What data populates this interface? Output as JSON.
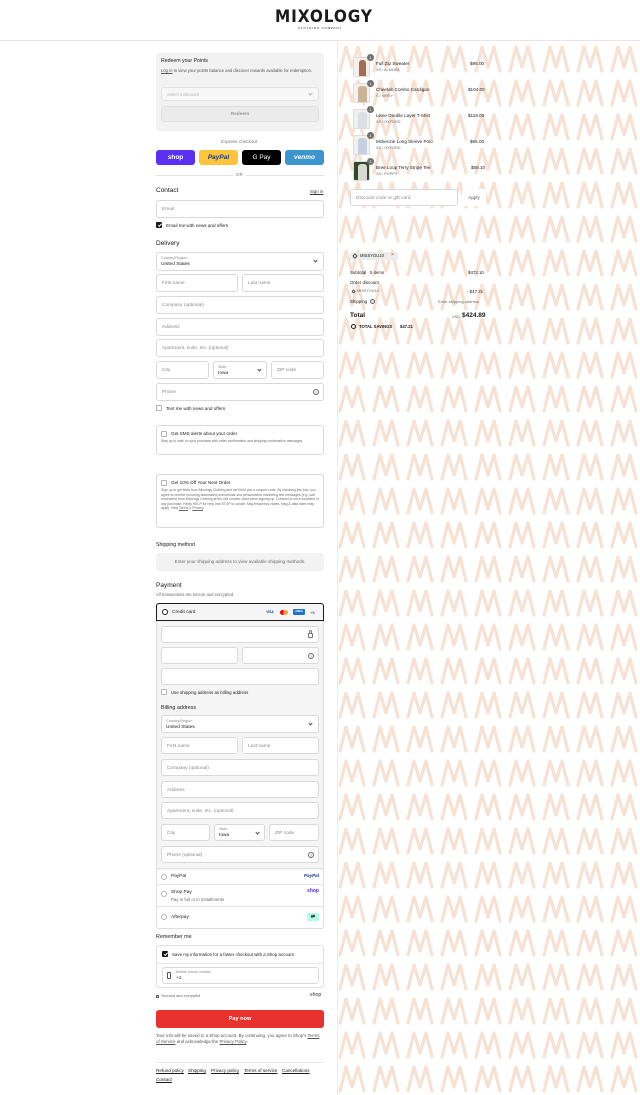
{
  "brand": {
    "name": "MIXOLOGY",
    "tagline": "CLOTHING COMPANY"
  },
  "rewards": {
    "title": "Redeem your Points",
    "login_link": "Log in",
    "text": " to view your points balance and discover rewards available for redemption.",
    "select_placeholder": "Select a discount",
    "redeem_label": "Redeem"
  },
  "express": {
    "label": "Express checkout",
    "or": "OR",
    "shop": "shop",
    "paypal": "PayPal",
    "gpay": "G Pay",
    "venmo": "venmo"
  },
  "contact": {
    "title": "Contact",
    "sign_in": "Sign in",
    "email_placeholder": "Email",
    "newsletter_label": "Email me with news and offers"
  },
  "delivery": {
    "title": "Delivery",
    "country_label": "Country/Region",
    "country": "United States",
    "first_name": "First name",
    "last_name": "Last name",
    "company": "Company (optional)",
    "address": "Address",
    "apartment": "Apartment, suite, etc. (optional)",
    "city": "City",
    "state_label": "State",
    "state": "Iowa",
    "zip": "ZIP code",
    "phone": "Phone",
    "text_offers": "Text me with news and offers"
  },
  "sms_box": {
    "title": "Get SMS alerts about your order",
    "desc": "Stay up to date on your purchase with order confirmation and shipping confirmation messages."
  },
  "promo_box": {
    "title": "Get 10% Off Your Next Order",
    "desc": "Sign up to get texts from Mixology Clothing and we'll text you a coupon code. By checking this box, you agree to receive recurring automated promotional and personalized marketing text messages (e.g. cart reminders) from Mixology Clothing at the cell number used when signing up. Consent is not a condition of any purchase. Reply HELP for help and STOP to cancel. Msg frequency varies. Msg & data rates may apply. View ",
    "terms": "Terms",
    "and": " & ",
    "privacy": "Privacy",
    "end": "."
  },
  "shipping_method": {
    "title": "Shipping method",
    "notice": "Enter your shipping address to view available shipping methods."
  },
  "payment": {
    "title": "Payment",
    "subtitle": "All transactions are secure and encrypted.",
    "credit_card": "Credit card",
    "cards": [
      "VISA",
      "MC",
      "AMEX",
      "+5"
    ],
    "use_shipping": "Use shipping address as billing address",
    "billing_title": "Billing address",
    "phone_optional": "Phone (optional)",
    "paypal": "PayPal",
    "shop_pay": "Shop Pay",
    "shop_pay_sub": "Pay in full or in installments",
    "afterpay": "Afterpay"
  },
  "remember": {
    "title": "Remember me",
    "save_label": "Save my information for a faster checkout with a Shop account",
    "mobile_label": "Mobile phone number",
    "mobile_value": "+1",
    "secure": "Secured and encrypted",
    "shop": "shop"
  },
  "pay_now": "Pay now",
  "disclaimer": {
    "text": "Your info will be saved to a Shop account. By continuing, you agree to Shop's ",
    "tos": "Terms of Service",
    "mid": " and acknowledge the ",
    "privacy": "Privacy Policy",
    "end": "."
  },
  "footer": [
    "Refund policy",
    "Shipping",
    "Privacy policy",
    "Terms of service",
    "Cancellations",
    "Contact"
  ],
  "cart": {
    "items": [
      {
        "qty": "1",
        "name": "Full Zip Sweater",
        "variant": "XS / ALMURA",
        "price": "$96.00"
      },
      {
        "qty": "1",
        "name": "Cheetah Combo Cardigan",
        "variant": "S / IVREY",
        "price": "$104.00"
      },
      {
        "qty": "1",
        "name": "Lexie Double Layer T-Shirt",
        "variant": "XS / OXFORD",
        "price": "$118.00"
      },
      {
        "qty": "1",
        "name": "Mckenzie Long Sleeve Polo",
        "variant": "XS / OXFORD",
        "price": "$96.00"
      },
      {
        "qty": "1",
        "name": "Bree Loop Terry Stripe Tee",
        "variant": "XS / POPPY",
        "price": "$58.10"
      }
    ],
    "discount_placeholder": "Discount code or gift card",
    "apply": "Apply",
    "code": "MISSYOU10",
    "subtotal_label": "Subtotal · 5 items",
    "subtotal": "$472.10",
    "order_discount": "Order discount",
    "discount_code": "MISSYOU10",
    "discount_value": "- $47.21",
    "shipping_label": "Shipping",
    "shipping_value": "Enter shipping address",
    "total_label": "Total",
    "currency": "USD",
    "total": "$424.89",
    "savings_label": "TOTAL SAVINGS",
    "savings": "$47.21"
  },
  "colors": {
    "pay_button": "#e8322d",
    "shop_purple": "#5a31f4",
    "paypal_yellow": "#ffc43a",
    "venmo_blue": "#3d95ce",
    "pattern": "#f6e1d3"
  }
}
